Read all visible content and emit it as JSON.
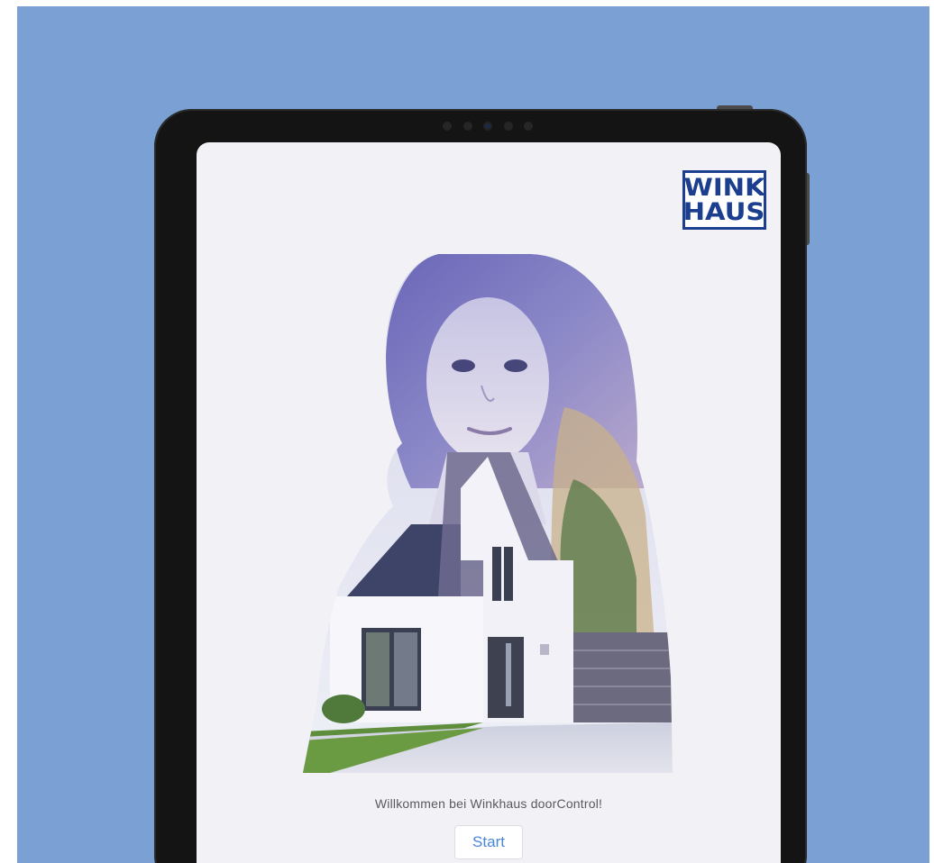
{
  "app": {
    "brand_lines": [
      "WINK",
      "HAUS"
    ],
    "welcome_text": "Willkommen bei Winkhaus doorControl!",
    "start_label": "Start"
  },
  "colors": {
    "background": "#7aa0d4",
    "screen": "#f2f1f6",
    "brand_blue": "#1c3e8e",
    "accent": "#4a86d6",
    "tablet_frame": "#141414"
  },
  "icons": {
    "logo": "winkhaus-logo",
    "hero": "woman-house-double-exposure"
  }
}
